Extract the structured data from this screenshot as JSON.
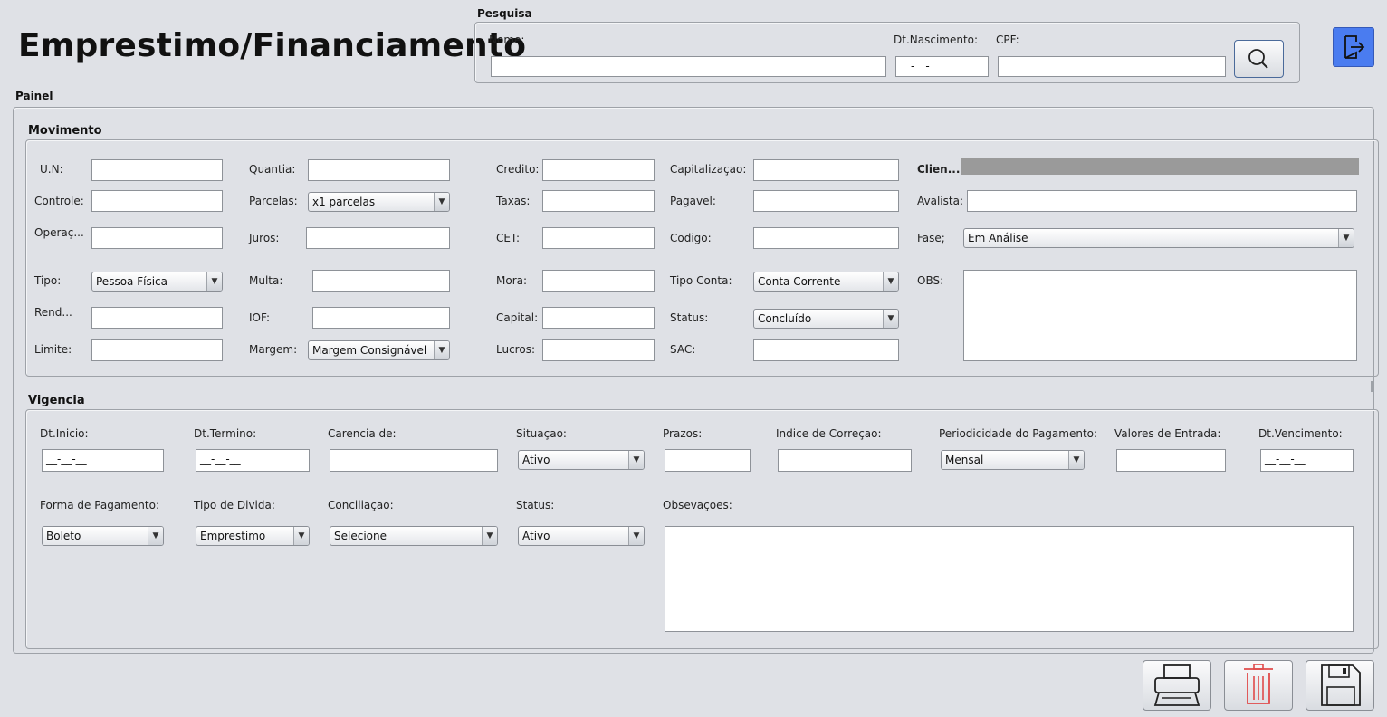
{
  "header": {
    "title": "Emprestimo/Financiamento"
  },
  "search": {
    "group_title": "Pesquisa",
    "nome_label": "Nome:",
    "nome_value": "",
    "nascimento_label": "Dt.Nascimento:",
    "nascimento_value": "__-__-__",
    "cpf_label": "CPF:",
    "cpf_value": ""
  },
  "painel": {
    "title": "Painel"
  },
  "movimento": {
    "title": "Movimento",
    "un_label": "U.N:",
    "controle_label": "Controle:",
    "operacao_label": "Operaç...",
    "tipo_label": "Tipo:",
    "tipo_value": "Pessoa Física",
    "rend_label": "Rend...",
    "limite_label": "Limite:",
    "quantia_label": "Quantia:",
    "parcelas_label": "Parcelas:",
    "parcelas_value": "x1 parcelas",
    "juros_label": "Juros:",
    "multa_label": "Multa:",
    "iof_label": "IOF:",
    "margem_label": "Margem:",
    "margem_value": "Margem Consignável",
    "credito_label": "Credito:",
    "taxas_label": "Taxas:",
    "cet_label": "CET:",
    "mora_label": "Mora:",
    "capital_label": "Capital:",
    "lucros_label": "Lucros:",
    "capitalizacao_label": "Capitalizaçao:",
    "pagavel_label": "Pagavel:",
    "codigo_label": "Codigo:",
    "tipo_conta_label": "Tipo Conta:",
    "tipo_conta_value": "Conta Corrente",
    "status_label": "Status:",
    "status_value": "Concluído",
    "sac_label": "SAC:",
    "cliente_label": "Clien...",
    "avalista_label": "Avalista:",
    "fase_label": "Fase;",
    "fase_value": "Em Análise",
    "obs_label": "OBS:"
  },
  "vigencia": {
    "title": "Vigencia",
    "dt_inicio_label": "Dt.Inicio:",
    "dt_inicio_value": "__-__-__",
    "dt_termino_label": "Dt.Termino:",
    "dt_termino_value": "__-__-__",
    "carencia_label": "Carencia de:",
    "situacao_label": "Situaçao:",
    "situacao_value": "Ativo",
    "prazos_label": "Prazos:",
    "indice_label": "Indice de Correçao:",
    "periodicidade_label": "Periodicidade do Pagamento:",
    "periodicidade_value": "Mensal",
    "valores_label": "Valores de Entrada:",
    "dt_vencimento_label": "Dt.Vencimento:",
    "dt_vencimento_value": "__-__-__",
    "forma_pagamento_label": "Forma de Pagamento:",
    "forma_pagamento_value": "Boleto",
    "tipo_divida_label": "Tipo de Divida:",
    "tipo_divida_value": "Emprestimo",
    "conciliacao_label": "Conciliaçao:",
    "conciliacao_value": "Selecione",
    "status_label": "Status:",
    "status_value": "Ativo",
    "observacoes_label": "Obsevaçoes:"
  },
  "icons": {
    "search": "search-icon",
    "exit": "exit-icon",
    "print": "printer-icon",
    "delete": "trash-icon",
    "save": "floppy-disk-icon"
  },
  "colors": {
    "exit_button": "#4a7cf0",
    "trash_icon": "#e04a4a"
  }
}
